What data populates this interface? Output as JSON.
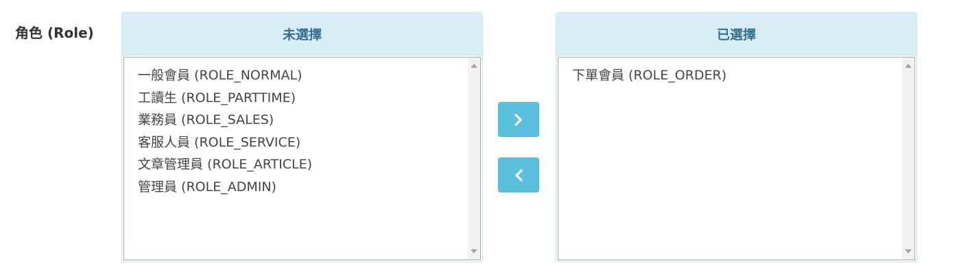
{
  "form": {
    "label": "角色 (Role)"
  },
  "available": {
    "heading": "未選擇",
    "items": [
      "一般會員 (ROLE_NORMAL)",
      "工讀生 (ROLE_PARTTIME)",
      "業務員 (ROLE_SALES)",
      "客服人員 (ROLE_SERVICE)",
      "文章管理員 (ROLE_ARTICLE)",
      "管理員 (ROLE_ADMIN)"
    ]
  },
  "selected": {
    "heading": "已選擇",
    "items": [
      "下單會員 (ROLE_ORDER)"
    ]
  },
  "buttons": {
    "add_icon": "chevron-right-icon",
    "remove_icon": "chevron-left-icon"
  },
  "colors": {
    "panel_heading_bg": "#d9edf7",
    "panel_heading_text": "#31708f",
    "panel_border": "#bce8f1",
    "button_bg": "#5bc0de"
  }
}
